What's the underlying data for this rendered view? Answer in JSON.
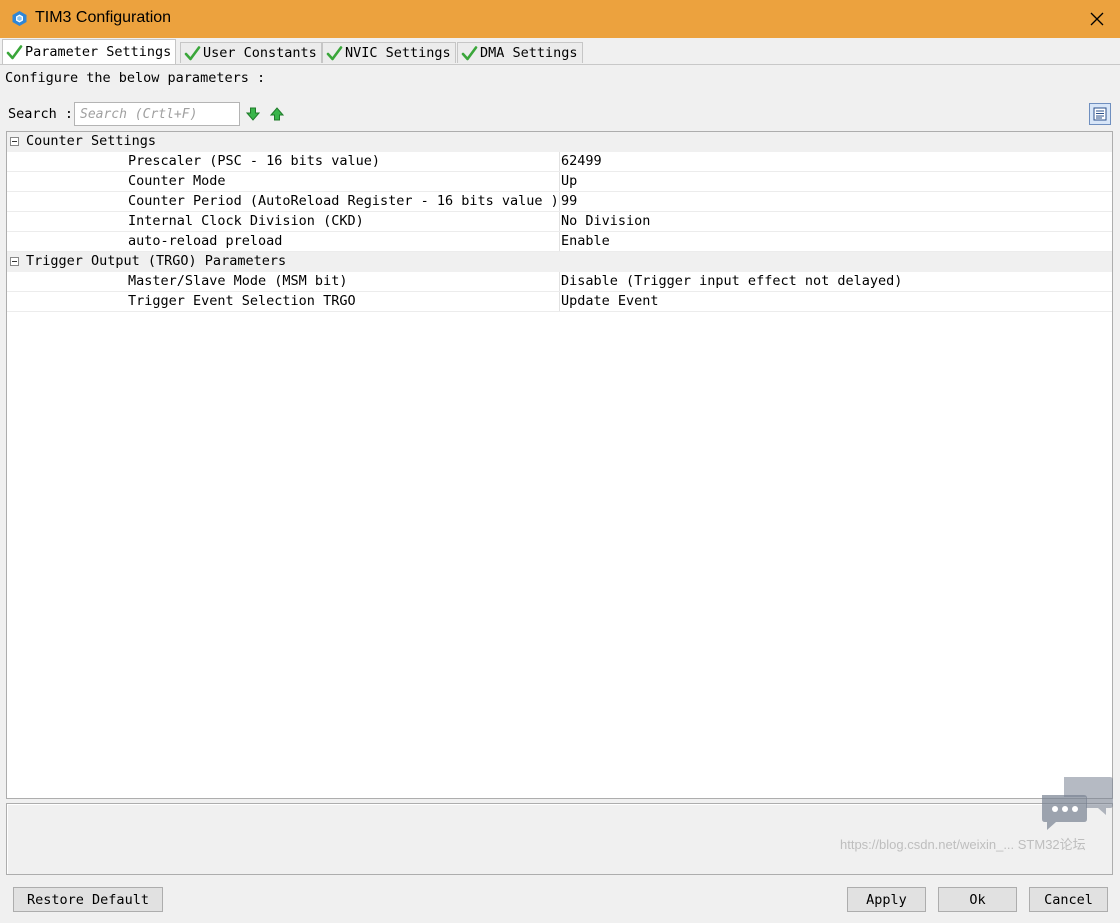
{
  "window": {
    "title": "TIM3 Configuration",
    "title_bar_color": "#eca23e",
    "icons": {
      "app": "cube-app-icon",
      "close": "close-icon"
    }
  },
  "tabs": [
    {
      "label": "Parameter Settings",
      "active": true,
      "icon": "green-check-icon"
    },
    {
      "label": "User Constants",
      "active": false,
      "icon": "green-check-icon"
    },
    {
      "label": "NVIC Settings",
      "active": false,
      "icon": "green-check-icon"
    },
    {
      "label": "DMA Settings",
      "active": false,
      "icon": "green-check-icon"
    }
  ],
  "instructions": "Configure the below parameters :",
  "search": {
    "label": "Search :",
    "placeholder": "Search (Crtl+F)",
    "value": "",
    "icons": [
      "arrow-down-icon",
      "arrow-up-icon",
      "view-toggle-icon"
    ]
  },
  "groups": [
    {
      "name": "Counter Settings",
      "expanded": true,
      "params": [
        {
          "name": "Prescaler (PSC - 16 bits value)",
          "value": "62499"
        },
        {
          "name": "Counter Mode",
          "value": "Up"
        },
        {
          "name": "Counter Period (AutoReload Register - 16 bits value )",
          "value": "99"
        },
        {
          "name": "Internal Clock Division (CKD)",
          "value": "No Division"
        },
        {
          "name": "auto-reload preload",
          "value": "Enable"
        }
      ]
    },
    {
      "name": "Trigger Output (TRGO) Parameters",
      "expanded": true,
      "params": [
        {
          "name": "Master/Slave Mode (MSM bit)",
          "value": "Disable (Trigger input effect not delayed)"
        },
        {
          "name": "Trigger Event Selection TRGO",
          "value": "Update Event"
        }
      ]
    }
  ],
  "buttons": {
    "restore_default": "Restore Default",
    "apply": "Apply",
    "ok": "Ok",
    "cancel": "Cancel"
  },
  "watermark": "https://blog.csdn.net/weixin_... STM32论坛"
}
